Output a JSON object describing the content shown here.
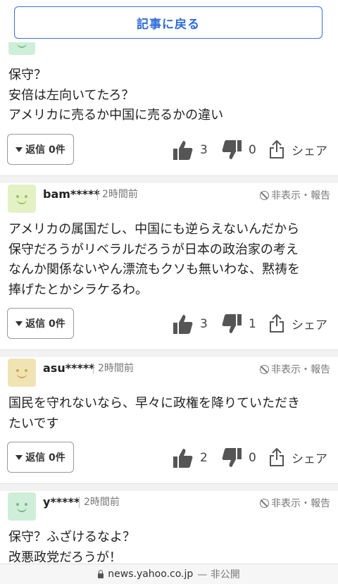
{
  "header": {
    "back_label": "記事に戻る"
  },
  "colors": {
    "accent": "#2f6bd8"
  },
  "comments": [
    {
      "body": "保守？\n安倍は左向いてたろ？\nアメリカに売るか中国に売るかの違い",
      "reply": "返信 0件",
      "likes": "3",
      "dislikes": "0",
      "share": "シェア"
    },
    {
      "user": "bam*****",
      "time": "2時間前",
      "report": "非表示・報告",
      "body": "アメリカの属国だし、中国にも逆らえないんだから\n保守だろうがリベラルだろうが日本の政治家の考え\nなんか関係ないやん漂流もクソも無いわな、黙祷を\n捧げたとかシラケるわ。",
      "reply": "返信 0件",
      "likes": "3",
      "dislikes": "1",
      "share": "シェア"
    },
    {
      "user": "asu*****",
      "time": "2時間前",
      "report": "非表示・報告",
      "body": "国民を守れないなら、早々に政権を降りていただき\nたいです",
      "reply": "返信 0件",
      "likes": "2",
      "dislikes": "0",
      "share": "シェア"
    },
    {
      "user": "y*****",
      "time": "2時間前",
      "report": "非表示・報告",
      "body": "保守？ふざけるなよ？\n改悪政党だろうが！"
    }
  ],
  "urlbar": {
    "domain": "news.yahoo.co.jp",
    "status": "— 非公開"
  },
  "icons": {
    "like": "thumbs-up-icon",
    "dislike": "thumbs-down-icon",
    "share": "share-icon",
    "hide": "hide-icon",
    "lock": "lock-icon"
  }
}
